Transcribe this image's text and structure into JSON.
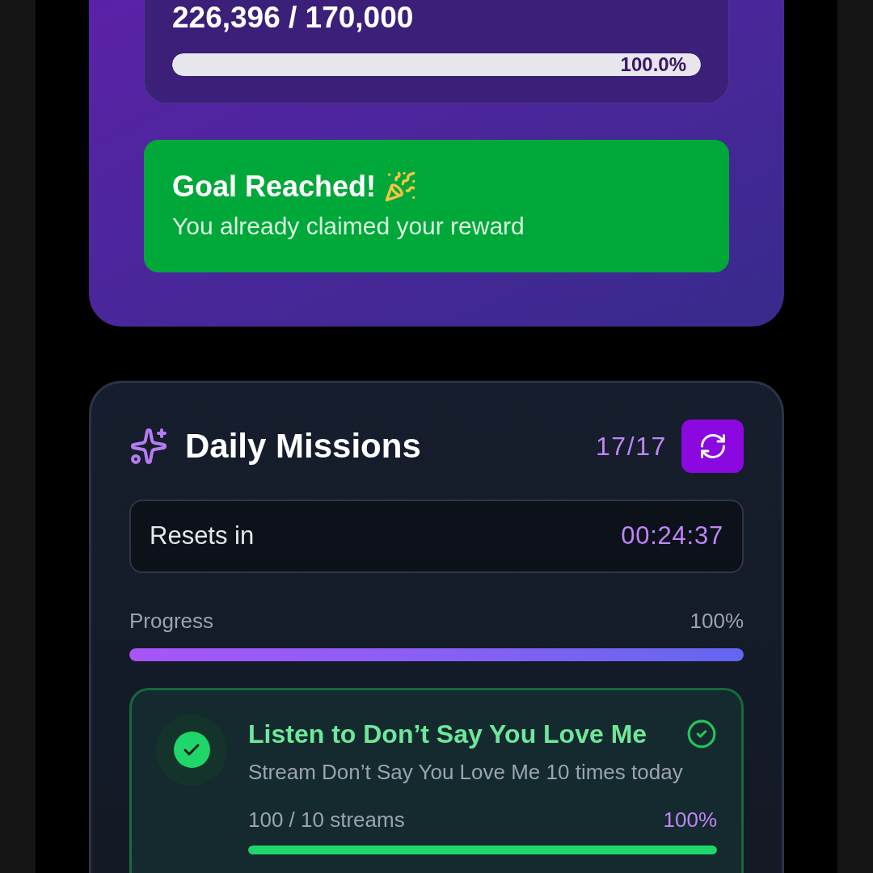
{
  "goal": {
    "amount": "226,396 / 170,000",
    "level": 1,
    "percent": "100.0%",
    "status": {
      "title": "Goal Reached!",
      "subtitle": "You already claimed your reward",
      "reached": true
    }
  },
  "missions": {
    "title": "Daily Missions",
    "count": "17/17",
    "reset_label": "Resets in",
    "reset_time": "00:24:37",
    "progress_label": "Progress",
    "progress_value": "100%",
    "level": 1,
    "items": [
      {
        "title": "Listen to Don’t Say You Love Me",
        "description": "Stream Don’t Say You Love Me 10 times today",
        "progress": "100 / 10 streams",
        "percent": "100%",
        "level": 1,
        "completed": true
      }
    ]
  }
}
